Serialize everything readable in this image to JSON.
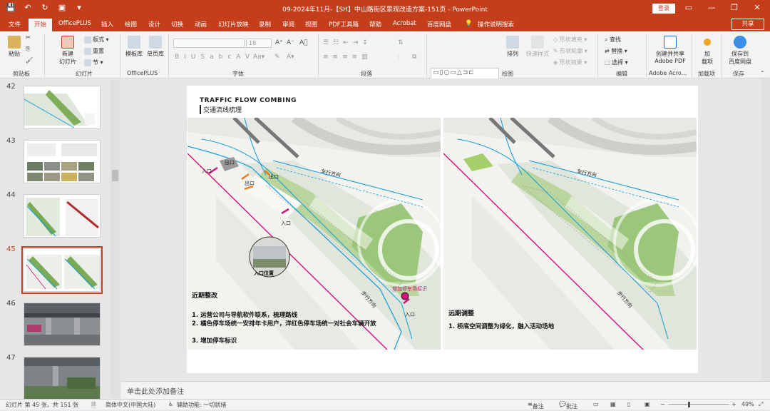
{
  "titlebar": {
    "title": "09-2024年11月-【SH】中山路街区景观改造方案-151页 - PowerPoint",
    "login": "登录"
  },
  "menu": {
    "tabs": [
      "文件",
      "开始",
      "OfficePLUS",
      "插入",
      "绘图",
      "设计",
      "切换",
      "动画",
      "幻灯片放映",
      "录制",
      "审阅",
      "视图",
      "PDF工具箱",
      "帮助",
      "Acrobat",
      "百度网盘"
    ],
    "active_tab": "开始",
    "tell_me": "操作说明搜索",
    "share": "共享"
  },
  "ribbon": {
    "clipboard": {
      "paste": "粘贴",
      "group": "剪贴板"
    },
    "slides": {
      "new_slide": "新建",
      "new_slide2": "幻灯片",
      "layout": "版式",
      "reset": "重置",
      "section": "节",
      "group": "幻灯片"
    },
    "officeplus": {
      "template": "模板库",
      "single_page": "单页库",
      "group": "OfficePLUS"
    },
    "font": {
      "size": "18",
      "group": "字体"
    },
    "paragraph": {
      "group": "段落"
    },
    "drawing": {
      "arrange": "排列",
      "quick_styles": "快速样式",
      "fill": "形状填充",
      "outline": "形状轮廓",
      "effects": "形状效果",
      "group": "绘图"
    },
    "editing": {
      "find": "查找",
      "replace": "替换",
      "select": "选择",
      "group": "编辑"
    },
    "adobe": {
      "create1": "创建并共享",
      "create2": "Adobe PDF",
      "group": "Adobe Acro..."
    },
    "addins": {
      "add1": "加",
      "add2": "载项",
      "group": "加载项"
    },
    "save": {
      "save1": "保存到",
      "save2": "百度网盘",
      "group": "保存"
    }
  },
  "thumbnails": [
    {
      "num": "42"
    },
    {
      "num": "43"
    },
    {
      "num": "44"
    },
    {
      "num": "45",
      "active": true
    },
    {
      "num": "46"
    },
    {
      "num": "47"
    }
  ],
  "slide": {
    "title_en": "TRAFFIC FLOW COMBING",
    "title_cn": "交通流线梳理",
    "left_map": {
      "labels": {
        "exit1": "出口",
        "exit2": "出口",
        "exit3": "出口",
        "entry1": "入口",
        "entry2": "入口",
        "entry3": "入口",
        "direction": "车行方向",
        "walk": "步行方向",
        "mark": "增加停车场标识",
        "photo": "入口位置"
      },
      "heading": "近期整改",
      "items": [
        "1. 运营公司与导航软件联系，梳理路线",
        "2. 橘色停车场统一安排年卡用户，洋红色停车场统一对社会车辆开放",
        "3. 增加停车标识"
      ]
    },
    "right_map": {
      "labels": {
        "direction": "车行方向",
        "walk": "步行方向"
      },
      "heading": "远期调整",
      "items": [
        "1. 桥底空间调整为绿化，融入活动场地"
      ]
    }
  },
  "notes": {
    "placeholder": "单击此处添加备注"
  },
  "status": {
    "slide_info": "幻灯片 第 45 张，共 151 张",
    "language": "简体中文(中国大陆)",
    "accessibility": "辅助功能: 一切就绪",
    "notes_btn": "备注",
    "comments_btn": "批注",
    "zoom": "49%"
  },
  "colors": {
    "accent": "#c43e1c",
    "blue_route": "#1a9fd8",
    "magenta_route": "#d6117f",
    "orange_mark": "#f07a1e",
    "green": "#6fa83a"
  }
}
